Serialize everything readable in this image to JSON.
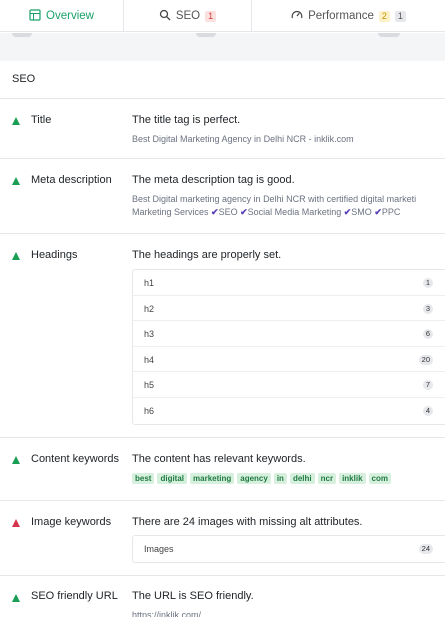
{
  "tabs": [
    {
      "label": "Overview",
      "icon": "overview-grid-icon"
    },
    {
      "label": "SEO",
      "icon": "search-icon",
      "badge": "1"
    },
    {
      "label": "Performance",
      "icon": "gauge-icon",
      "badge_warn": "2",
      "badge_info": "1"
    }
  ],
  "section_title": "SEO",
  "rows": {
    "title": {
      "label": "Title",
      "main": "The title tag is perfect.",
      "sub": "Best Digital Marketing Agency in Delhi NCR - inklik.com"
    },
    "meta": {
      "label": "Meta description",
      "main": "The meta description tag is good.",
      "sub1": "Best Digital marketing agency in Delhi NCR with certified digital marketi",
      "sub2_prefix": "Marketing Services",
      "sub2_items": [
        "SEO",
        "Social Media Marketing",
        "SMO",
        "PPC"
      ],
      "check": "✔"
    },
    "headings": {
      "label": "Headings",
      "main": "The headings are properly set.",
      "items": [
        {
          "name": "h1",
          "count": "1"
        },
        {
          "name": "h2",
          "count": "3"
        },
        {
          "name": "h3",
          "count": "6"
        },
        {
          "name": "h4",
          "count": "20"
        },
        {
          "name": "h5",
          "count": "7"
        },
        {
          "name": "h6",
          "count": "4"
        }
      ]
    },
    "keywords": {
      "label": "Content keywords",
      "main": "The content has relevant keywords.",
      "items": [
        "best",
        "digital",
        "marketing",
        "agency",
        "in",
        "delhi",
        "ncr",
        "inklik",
        "com"
      ]
    },
    "images": {
      "label": "Image keywords",
      "main": "There are 24 images with missing alt attributes.",
      "item": {
        "name": "Images",
        "count": "24"
      }
    },
    "url": {
      "label": "SEO friendly URL",
      "main": "The URL is SEO friendly.",
      "sub": "https://inklik.com/"
    }
  },
  "colors": {
    "accent": "#17a26b",
    "pass": "#1a9e54",
    "fail": "#d5344c"
  }
}
